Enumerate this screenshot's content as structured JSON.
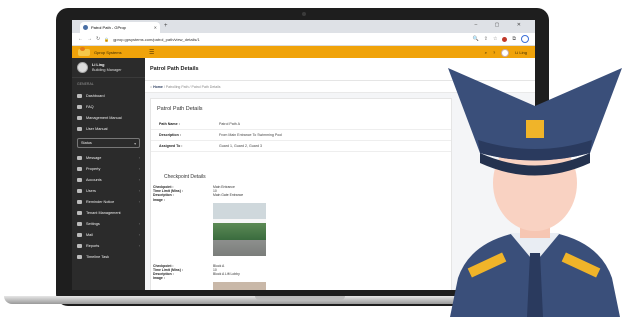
{
  "browser": {
    "tab_title": "Patrol Path - GProp",
    "url": "gprop.gpsystems.com/patrol_path/view_details/1",
    "window_controls": "– ▢ ✕"
  },
  "header": {
    "brand": "Gprop Systems",
    "user_name": "Li Ling"
  },
  "sidebar": {
    "user_name": "Li Ling",
    "user_role": "Building Manager",
    "section_label": "GENERAL",
    "items": [
      {
        "label": "Dashboard"
      },
      {
        "label": "FAQ"
      },
      {
        "label": "Management Manual"
      },
      {
        "label": "User Manual"
      }
    ],
    "status_label": "Status",
    "items2": [
      {
        "label": "Message"
      },
      {
        "label": "Property"
      },
      {
        "label": "Accounts"
      },
      {
        "label": "Users"
      },
      {
        "label": "Reminder Notice"
      },
      {
        "label": "Tenant Management"
      },
      {
        "label": "Settings"
      },
      {
        "label": "Mail"
      },
      {
        "label": "Reports"
      },
      {
        "label": "Timeline Task"
      }
    ]
  },
  "main": {
    "page_title": "Patrol Path Details",
    "breadcrumb": {
      "home": "Home",
      "sep1": "/",
      "section": "Patrolling Path",
      "sep2": "/",
      "current": "Patrol Path Details"
    },
    "details_title": "Patrol Path Details",
    "details": [
      {
        "key": "Path Name :",
        "value": "Patrol Path A"
      },
      {
        "key": "Description :",
        "value": "From Main Entrance To Swimming Pool"
      },
      {
        "key": "Assigned To :",
        "value": "Guard 1, Guard 2, Guard 3"
      }
    ],
    "checkpoints_title": "Checkpoint Details",
    "checkpoints": [
      {
        "checkpoint_label": "Checkpoint :",
        "checkpoint": "Main Entrance",
        "time_label": "Time Limit (Mins) :",
        "time": "10",
        "desc_label": "Description :",
        "desc": "Main Gate Entrance",
        "image_label": "Image :"
      },
      {
        "checkpoint_label": "Checkpoint :",
        "checkpoint": "Block A",
        "time_label": "Time Limit (Mins) :",
        "time": "10",
        "desc_label": "Description :",
        "desc": "Block A Lift Lobby",
        "image_label": "Image :"
      }
    ]
  },
  "colors": {
    "accent": "#f0a30a",
    "sidebar": "#2b2b2b",
    "guard_uniform": "#3a4f7a"
  }
}
